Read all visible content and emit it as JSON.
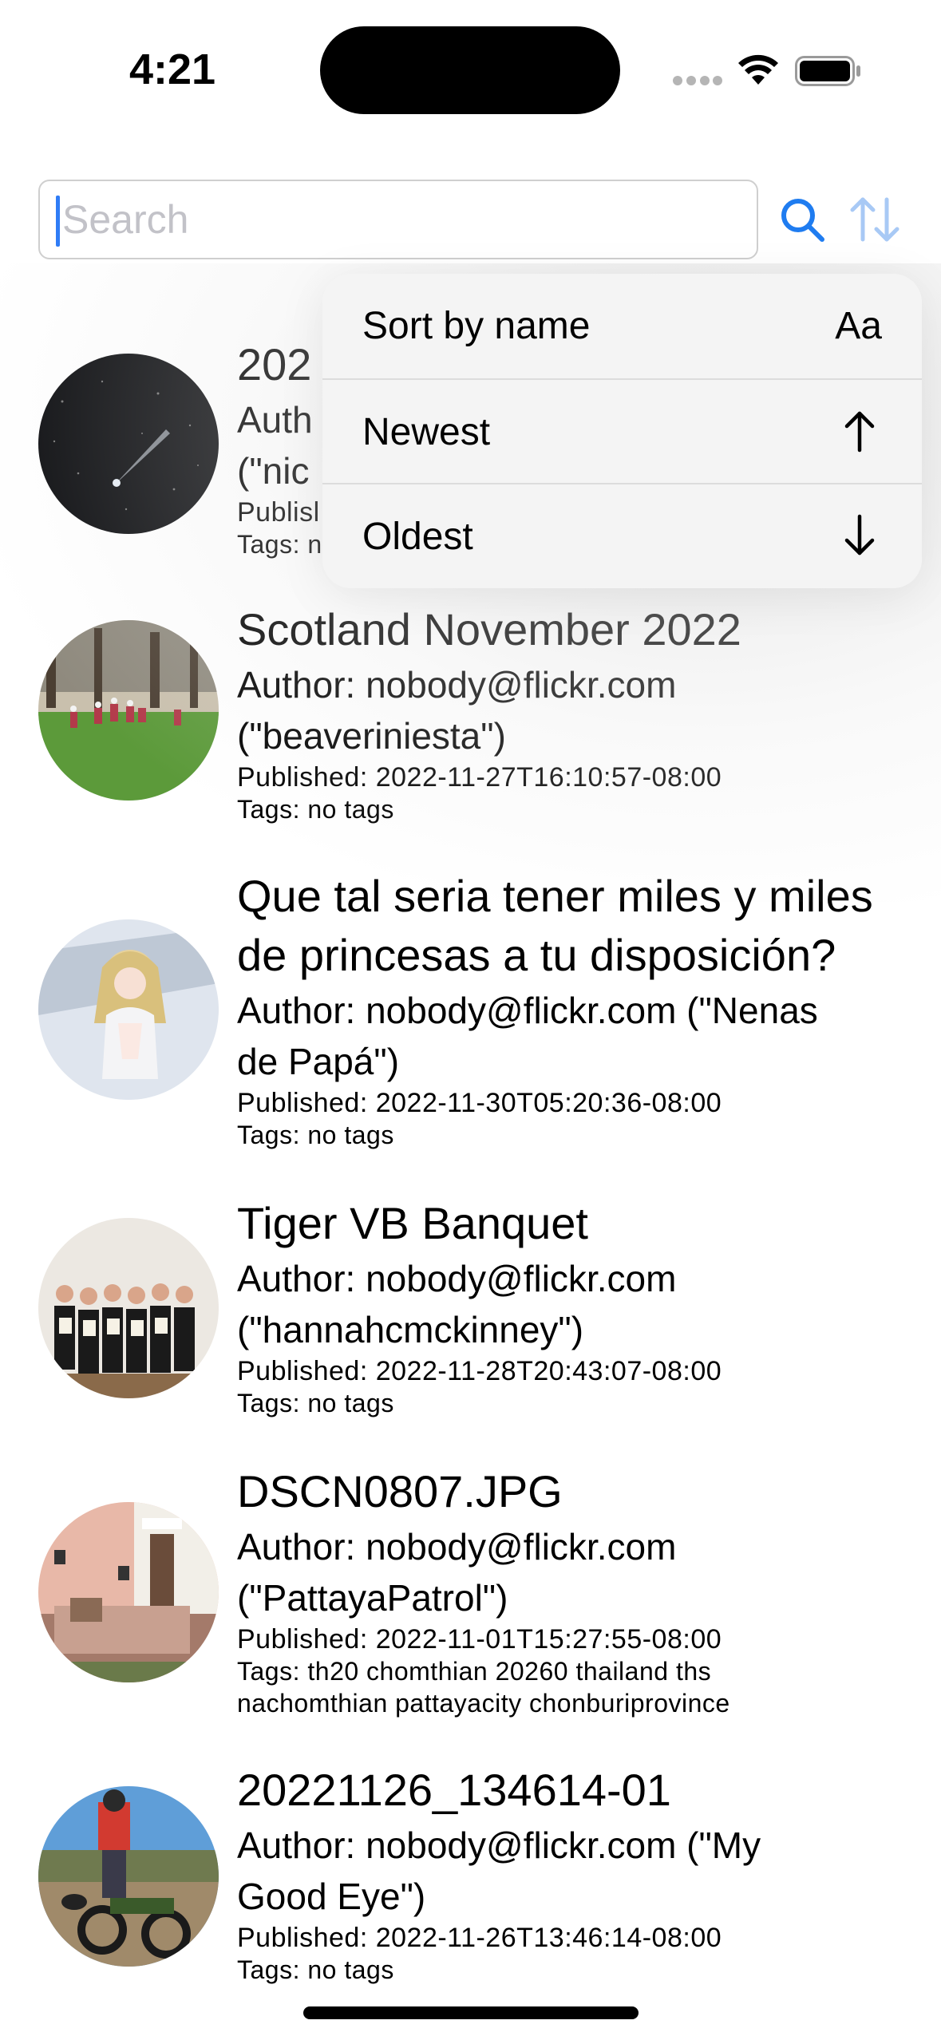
{
  "status_bar": {
    "time": "4:21"
  },
  "search": {
    "placeholder": "Search",
    "value": ""
  },
  "sort_menu": {
    "items": [
      {
        "label": "Sort by name",
        "icon": "Aa"
      },
      {
        "label": "Newest",
        "icon": "arrow-up-icon"
      },
      {
        "label": "Oldest",
        "icon": "arrow-down-icon"
      }
    ]
  },
  "feed": [
    {
      "title": "202",
      "author": "Auth",
      "author_cont": "(\"nic",
      "published": "Publisl",
      "tags": "Tags: n"
    },
    {
      "title": "Scotland November 2022",
      "author": "Author: nobody@flickr.com",
      "author_cont": "(\"beaveriniesta\")",
      "published": "Published: 2022-11-27T16:10:57-08:00",
      "tags": "Tags: no tags"
    },
    {
      "title": "Que tal seria tener miles y miles",
      "title_cont": "de princesas a tu disposición?",
      "author": "Author: nobody@flickr.com (\"Nenas",
      "author_cont": "de Papá\")",
      "published": "Published: 2022-11-30T05:20:36-08:00",
      "tags": "Tags: no tags"
    },
    {
      "title": "Tiger VB Banquet",
      "author": "Author: nobody@flickr.com",
      "author_cont": "(\"hannahcmckinney\")",
      "published": "Published: 2022-11-28T20:43:07-08:00",
      "tags": "Tags: no tags"
    },
    {
      "title": "DSCN0807.JPG",
      "author": "Author: nobody@flickr.com",
      "author_cont": "(\"PattayaPatrol\")",
      "published": "Published: 2022-11-01T15:27:55-08:00",
      "tags": "Tags: th20 chomthian 20260 thailand ths",
      "tags_cont": "nachomthian pattayacity chonburiprovince"
    },
    {
      "title": "20221126_134614-01",
      "author": "Author: nobody@flickr.com (\"My",
      "author_cont": "Good Eye\")",
      "published": "Published: 2022-11-26T13:46:14-08:00",
      "tags": "Tags: no tags"
    }
  ],
  "colors": {
    "accent": "#1f7cf0",
    "accent_light": "#a8c9f5"
  }
}
